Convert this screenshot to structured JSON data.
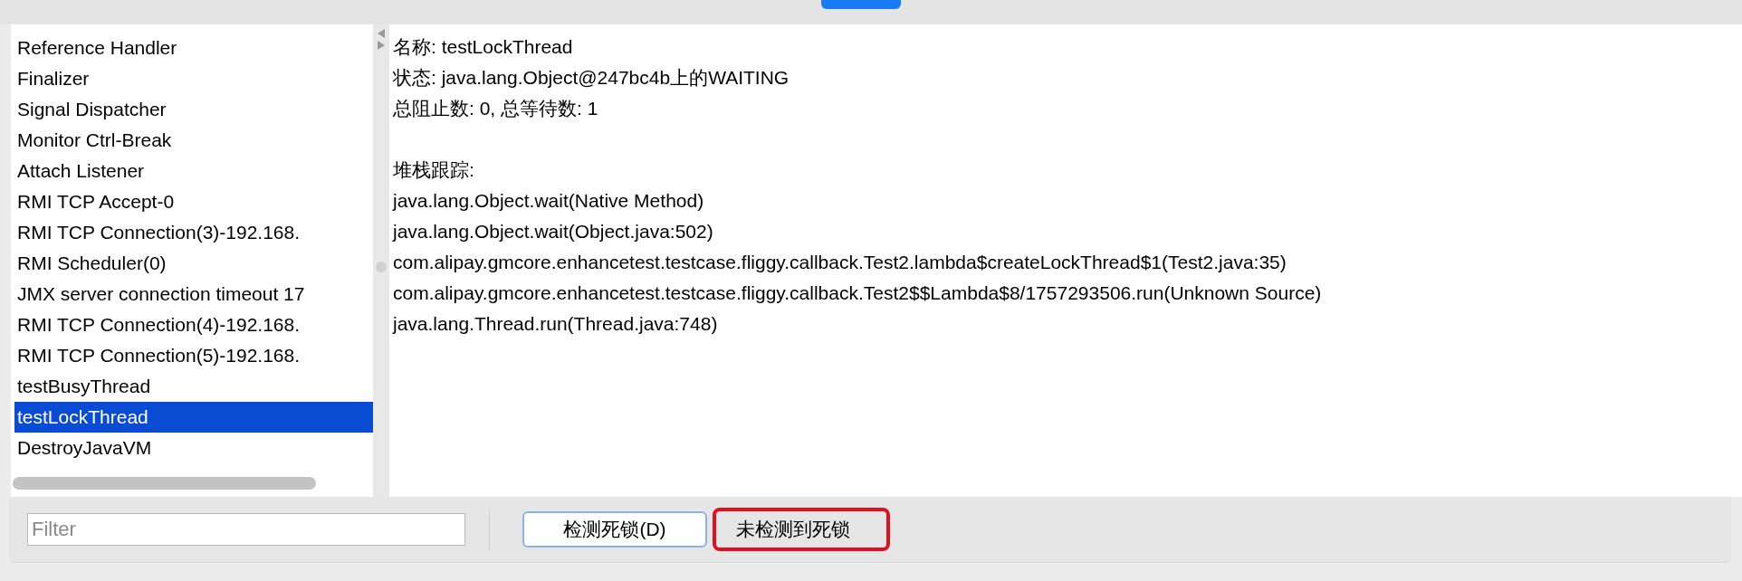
{
  "threads": [
    {
      "label": "Reference Handler",
      "selected": false
    },
    {
      "label": "Finalizer",
      "selected": false
    },
    {
      "label": "Signal Dispatcher",
      "selected": false
    },
    {
      "label": "Monitor Ctrl-Break",
      "selected": false
    },
    {
      "label": "Attach Listener",
      "selected": false
    },
    {
      "label": "RMI TCP Accept-0",
      "selected": false
    },
    {
      "label": "RMI TCP Connection(3)-192.168.",
      "selected": false
    },
    {
      "label": "RMI Scheduler(0)",
      "selected": false
    },
    {
      "label": "JMX server connection timeout 17",
      "selected": false
    },
    {
      "label": "RMI TCP Connection(4)-192.168.",
      "selected": false
    },
    {
      "label": "RMI TCP Connection(5)-192.168.",
      "selected": false
    },
    {
      "label": "testBusyThread",
      "selected": false
    },
    {
      "label": "testLockThread",
      "selected": true
    },
    {
      "label": "DestroyJavaVM",
      "selected": false
    }
  ],
  "details": {
    "info_lines": [
      "名称: testLockThread",
      "状态: java.lang.Object@247bc4b上的WAITING",
      "总阻止数: 0, 总等待数: 1"
    ],
    "stack_heading": "堆栈跟踪:",
    "stack_frames": [
      "java.lang.Object.wait(Native Method)",
      "java.lang.Object.wait(Object.java:502)",
      "com.alipay.gmcore.enhancetest.testcase.fliggy.callback.Test2.lambda$createLockThread$1(Test2.java:35)",
      "com.alipay.gmcore.enhancetest.testcase.fliggy.callback.Test2$$Lambda$8/1757293506.run(Unknown Source)",
      "java.lang.Thread.run(Thread.java:748)"
    ]
  },
  "filter": {
    "placeholder": "Filter"
  },
  "detect_button": "检测死锁(D)",
  "result_label": "未检测到死锁"
}
